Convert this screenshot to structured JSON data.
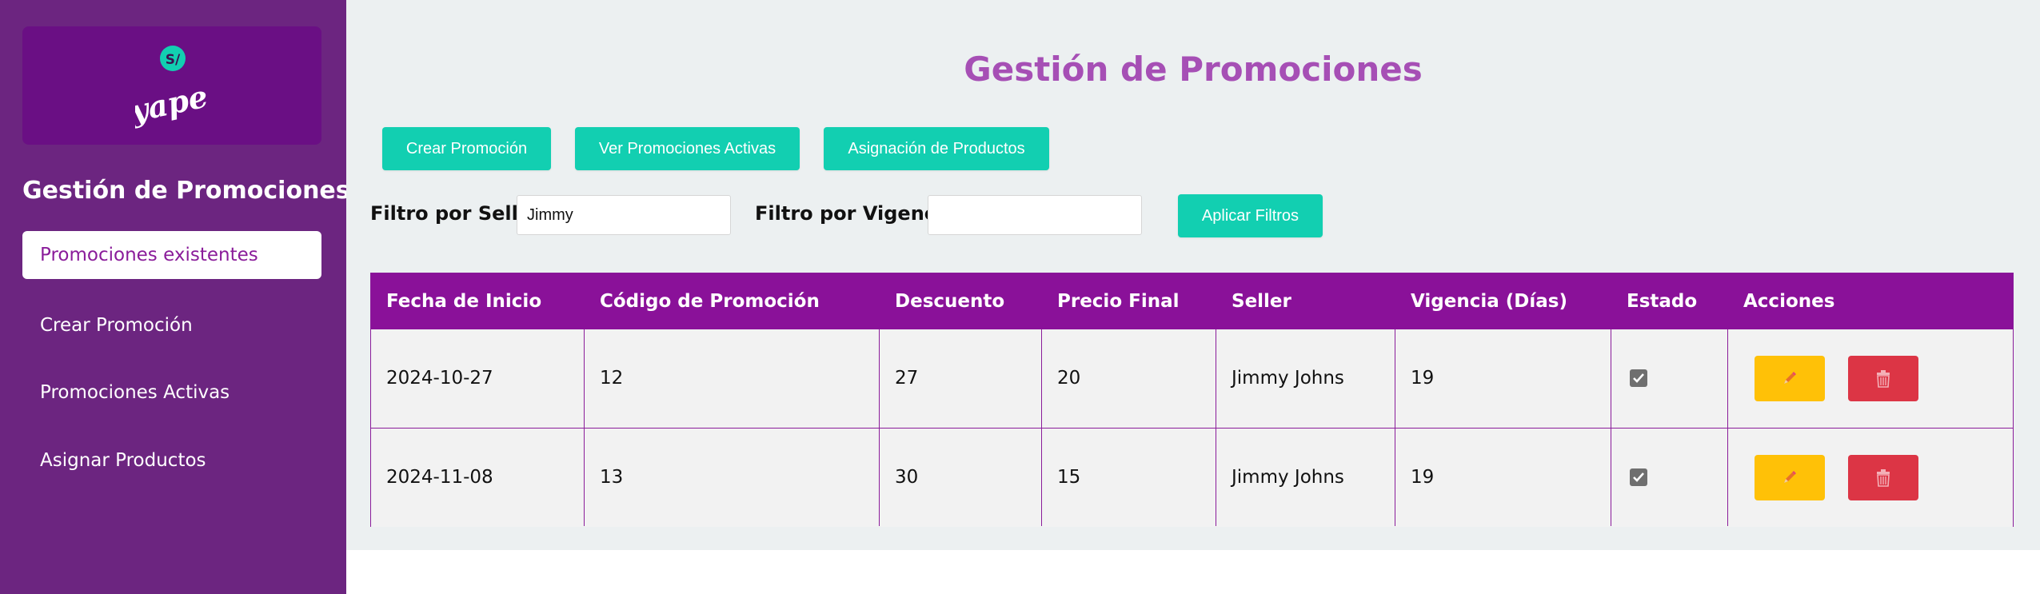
{
  "sidebar": {
    "logo_text": "yape",
    "title": "Gestión de Promociones",
    "items": [
      {
        "label": "Promociones existentes",
        "active": true
      },
      {
        "label": "Crear Promoción",
        "active": false
      },
      {
        "label": "Promociones Activas",
        "active": false
      },
      {
        "label": "Asignar Productos",
        "active": false
      }
    ]
  },
  "main": {
    "title": "Gestión de Promociones",
    "buttons": {
      "create": "Crear Promoción",
      "view_active": "Ver Promociones Activas",
      "assign": "Asignación de Productos",
      "apply_filters": "Aplicar Filtros"
    },
    "filters": {
      "seller_label": "Filtro por Seller:",
      "seller_value": "Jimmy",
      "vigencia_label": "Filtro por Vigencia:",
      "vigencia_value": ""
    },
    "table": {
      "headers": [
        "Fecha de Inicio",
        "Código de Promoción",
        "Descuento",
        "Precio Final",
        "Seller",
        "Vigencia (Días)",
        "Estado",
        "Acciones"
      ],
      "rows": [
        {
          "fecha": "2024-10-27",
          "codigo": "12",
          "descuento": "27",
          "precio": "20",
          "seller": "Jimmy Johns",
          "vigencia": "19",
          "estado": true
        },
        {
          "fecha": "2024-11-08",
          "codigo": "13",
          "descuento": "30",
          "precio": "15",
          "seller": "Jimmy Johns",
          "vigencia": "19",
          "estado": true
        }
      ]
    }
  },
  "colors": {
    "sidebar_bg": "#6c2580",
    "accent_teal": "#12cfb1",
    "table_header": "#8a1199",
    "title_purple": "#a64fb5",
    "edit_yellow": "#ffc107",
    "delete_red": "#dc3545"
  },
  "icons": {
    "edit": "pencil-icon",
    "delete": "trash-icon",
    "status": "checkbox-checked-icon"
  }
}
